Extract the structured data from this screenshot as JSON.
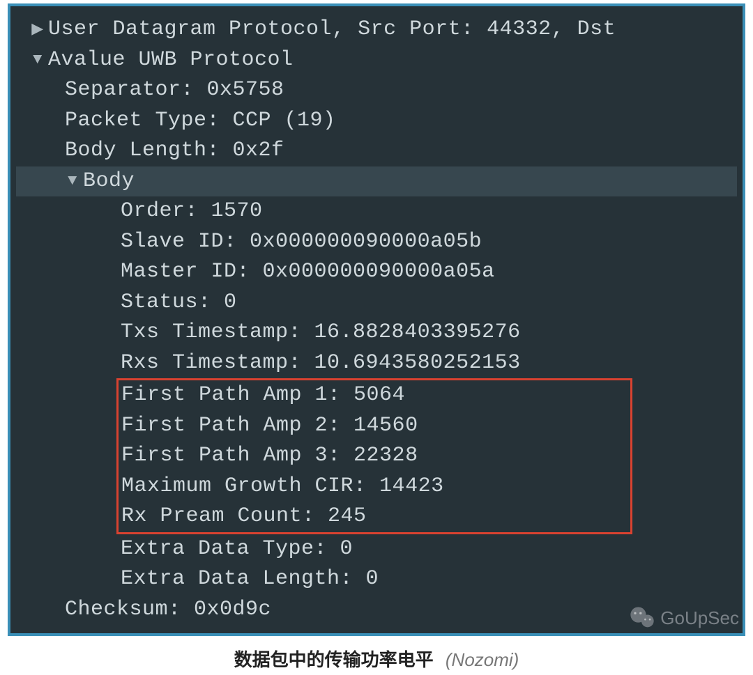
{
  "packet": {
    "udp_line": "User Datagram Protocol, Src Port: 44332, Dst",
    "protocol_line": "Avalue UWB Protocol",
    "fields": {
      "separator": "Separator: 0x5758",
      "packet_type": "Packet Type: CCP (19)",
      "body_length": "Body Length: 0x2f",
      "body_label": "Body",
      "order": "Order: 1570",
      "slave_id": "Slave ID: 0x000000090000a05b",
      "master_id": "Master ID: 0x000000090000a05a",
      "status": "Status: 0",
      "txs": "Txs Timestamp: 16.8828403395276",
      "rxs": "Rxs Timestamp: 10.6943580252153",
      "amp1": "First Path Amp 1: 5064",
      "amp2": "First Path Amp 2: 14560",
      "amp3": "First Path Amp 3: 22328",
      "cir": "Maximum Growth CIR: 14423",
      "pream": "Rx Pream Count: 245",
      "extra_type": "Extra Data Type: 0",
      "extra_len": "Extra Data Length: 0",
      "checksum": "Checksum: 0x0d9c"
    }
  },
  "caption": {
    "main": "数据包中的传输功率电平",
    "source": "(Nozomi)"
  },
  "watermark": "GoUpSec"
}
